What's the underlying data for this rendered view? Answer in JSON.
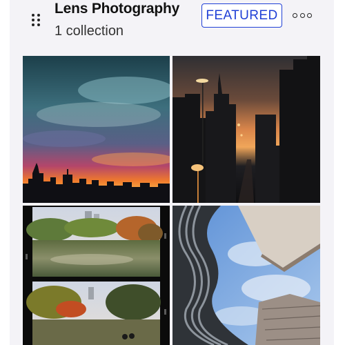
{
  "collection": {
    "title": "Lens Photography",
    "subtitle": "1 collection",
    "badge": "FEATURED"
  },
  "icons": {
    "drag": "drag-handle-icon",
    "more": "more-options-icon"
  },
  "colors": {
    "accent": "#1f3fd6",
    "card_background": "#f4f3f7"
  },
  "photos": [
    {
      "name": "city-skyline-sunset-photo"
    },
    {
      "name": "city-street-dusk-photo"
    },
    {
      "name": "park-lake-film-strip-photo"
    },
    {
      "name": "building-sky-upward-photo"
    }
  ]
}
